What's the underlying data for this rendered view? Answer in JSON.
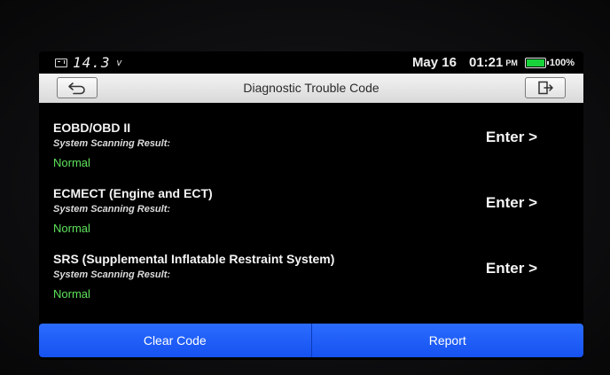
{
  "status": {
    "voltage": "14.3",
    "voltage_unit": "v",
    "date": "May 16",
    "time": "01:21",
    "ampm": "PM",
    "battery_percent": "100%",
    "battery_color": "#19d13a"
  },
  "header": {
    "title": "Diagnostic Trouble Code",
    "back_icon": "back-arrow-icon",
    "exit_icon": "exit-icon"
  },
  "systems": [
    {
      "name": "EOBD/OBD II",
      "subtitle": "System Scanning Result:",
      "status": "Normal",
      "action": "Enter >"
    },
    {
      "name": "ECMECT (Engine and ECT)",
      "subtitle": "System Scanning Result:",
      "status": "Normal",
      "action": "Enter >"
    },
    {
      "name": "SRS (Supplemental Inflatable Restraint System)",
      "subtitle": "System Scanning Result:",
      "status": "Normal",
      "action": "Enter >"
    }
  ],
  "footer": {
    "clear_label": "Clear Code",
    "report_label": "Report"
  },
  "colors": {
    "accent": "#1d5cf6",
    "status_ok": "#5fe35b"
  }
}
